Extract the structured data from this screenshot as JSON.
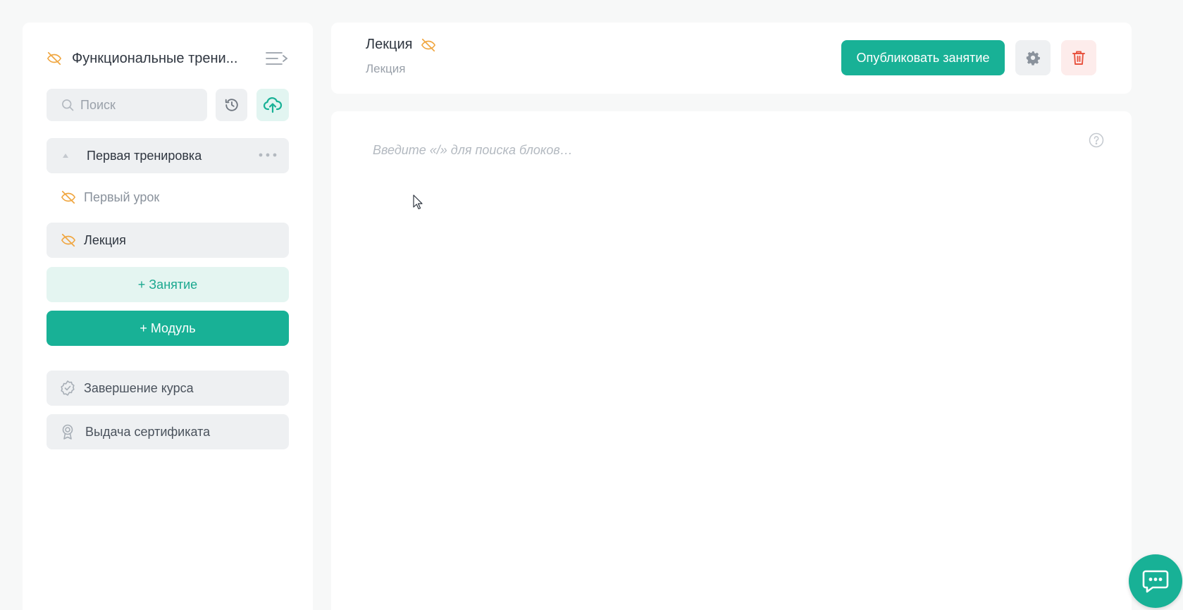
{
  "sidebar": {
    "course_title": "Функциональные трени...",
    "search": {
      "placeholder": "Поиск",
      "value": ""
    },
    "module": {
      "label": "Первая тренировка"
    },
    "lessons": [
      {
        "label": "Первый урок",
        "hidden_icon": "eye-off-icon"
      },
      {
        "label": "Лекция",
        "hidden_icon": "eye-off-icon",
        "selected": true
      }
    ],
    "add_lesson_label": "+ Занятие",
    "add_module_label": "+ Модуль",
    "finish_label": "Завершение курса",
    "certificate_label": "Выдача сертификата"
  },
  "header": {
    "title": "Лекция",
    "subtitle": "Лекция",
    "publish_label": "Опубликовать занятие"
  },
  "editor": {
    "placeholder": "Введите «/» для поиска блоков…",
    "value": ""
  },
  "colors": {
    "accent": "#18b196",
    "accent_light": "#e4f5f1",
    "hidden_icon": "#f0a640",
    "danger": "#e8533f",
    "danger_light": "#fdeceb",
    "panel_bg": "#ffffff",
    "page_bg": "#f7f8f8",
    "item_bg": "#eef0f2"
  },
  "icons": {
    "collapse": "collapse-sidebar-icon",
    "search": "search-icon",
    "history": "history-icon",
    "upload": "cloud-upload-icon",
    "settings": "gear-icon",
    "delete": "trash-icon",
    "help": "help-icon",
    "chat": "chat-icon",
    "finish": "badge-check-icon",
    "certificate": "award-icon"
  }
}
